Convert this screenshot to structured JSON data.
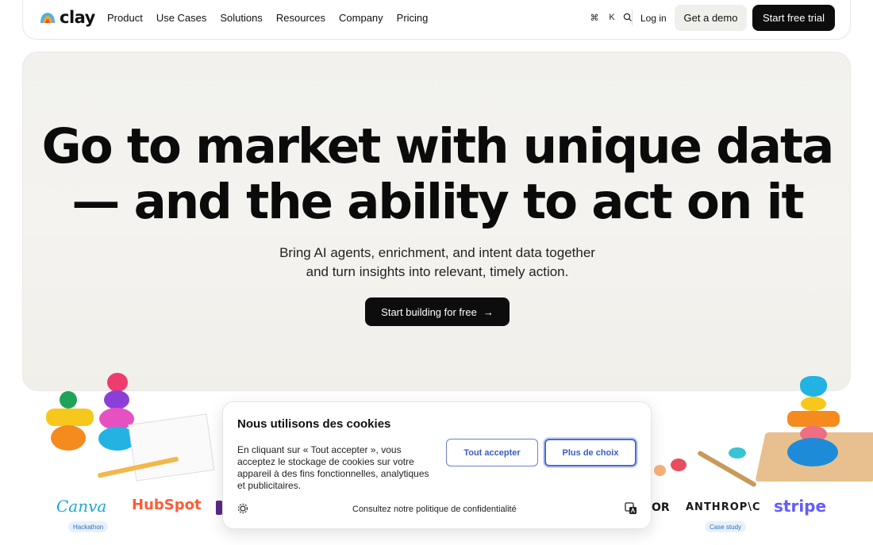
{
  "brand": {
    "name": "clay"
  },
  "nav": {
    "links": [
      "Product",
      "Use Cases",
      "Solutions",
      "Resources",
      "Company",
      "Pricing"
    ],
    "shortcut_cmd": "⌘",
    "shortcut_key": "K",
    "login": "Log in",
    "demo": "Get a demo",
    "trial": "Start free trial"
  },
  "hero": {
    "title_line1": "Go to market with unique data",
    "title_line2": "— and the ability to act on it",
    "subtitle_line1": "Bring AI agents, enrichment, and intent data together",
    "subtitle_line2": "and turn insights into relevant, timely action.",
    "cta": "Start building for free",
    "cta_arrow": "→"
  },
  "logos": {
    "canva": "Canva",
    "canva_tag": "Hackathon",
    "hubspot": "HubSpot",
    "or_fragment": "OR",
    "anthropic": "ANTHROP\\C",
    "anthropic_tag": "Case study",
    "stripe": "stripe"
  },
  "cookie": {
    "title": "Nous utilisons des cookies",
    "body": "En cliquant sur « Tout accepter », vous acceptez le stockage de cookies sur votre appareil à des fins fonctionnelles, analytiques et publicitaires.",
    "accept": "Tout accepter",
    "more": "Plus de choix",
    "policy_link": "Consultez notre politique de confidentialité"
  },
  "colors": {
    "accent_blue": "#3a5bc7",
    "stripe": "#635bff",
    "hubspot": "#ff5c35",
    "canva": "#1aa6d6"
  },
  "icons": [
    "clay-logo-icon",
    "command-icon",
    "search-icon",
    "arrow-right-icon",
    "gear-icon",
    "translate-icon"
  ]
}
